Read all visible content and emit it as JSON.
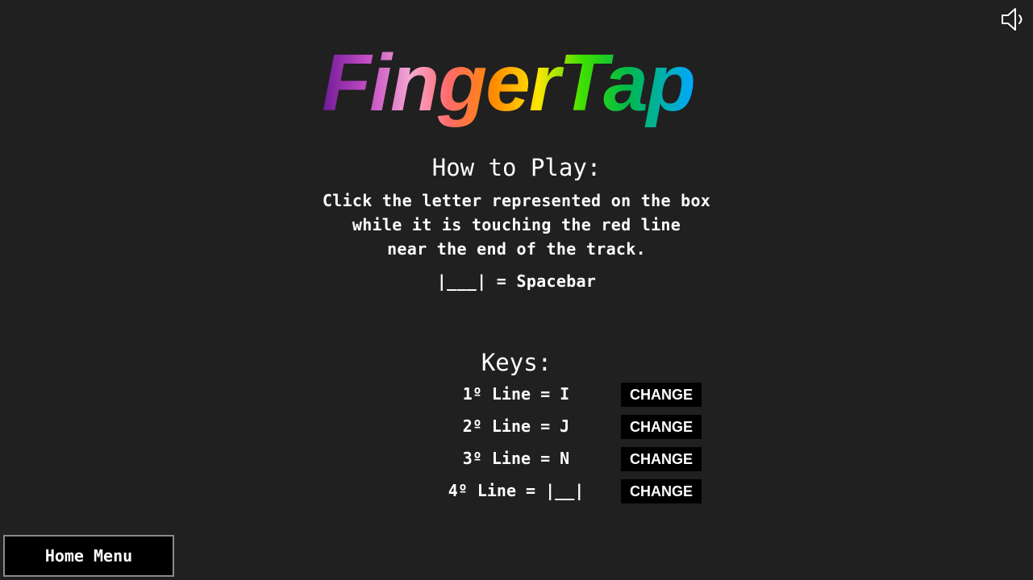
{
  "app": {
    "title": "FingerTap"
  },
  "header": {
    "sound_icon": "speaker-icon"
  },
  "howto": {
    "title": "How to Play:",
    "lines": [
      "Click the letter represented on the box",
      "while it is touching the red line",
      "near the end of the track."
    ],
    "spacebar_note": "|___| = Spacebar"
  },
  "keys": {
    "title": "Keys:",
    "items": [
      {
        "label": "1º Line = I",
        "button": "CHANGE"
      },
      {
        "label": "2º Line = J",
        "button": "CHANGE"
      },
      {
        "label": "3º Line = N",
        "button": "CHANGE"
      },
      {
        "label": "4º Line = |__|",
        "button": "CHANGE"
      }
    ]
  },
  "footer": {
    "home_button": "Home Menu"
  },
  "colors": {
    "background": "#202020",
    "text": "#ffffff",
    "button_bg": "#000000",
    "logo_gradient": [
      "#7a1fa2",
      "#c84fc8",
      "#f5a6d0",
      "#ff5a5a",
      "#ff8a00",
      "#ffe600",
      "#38e000",
      "#00c060",
      "#00a8ff"
    ]
  }
}
